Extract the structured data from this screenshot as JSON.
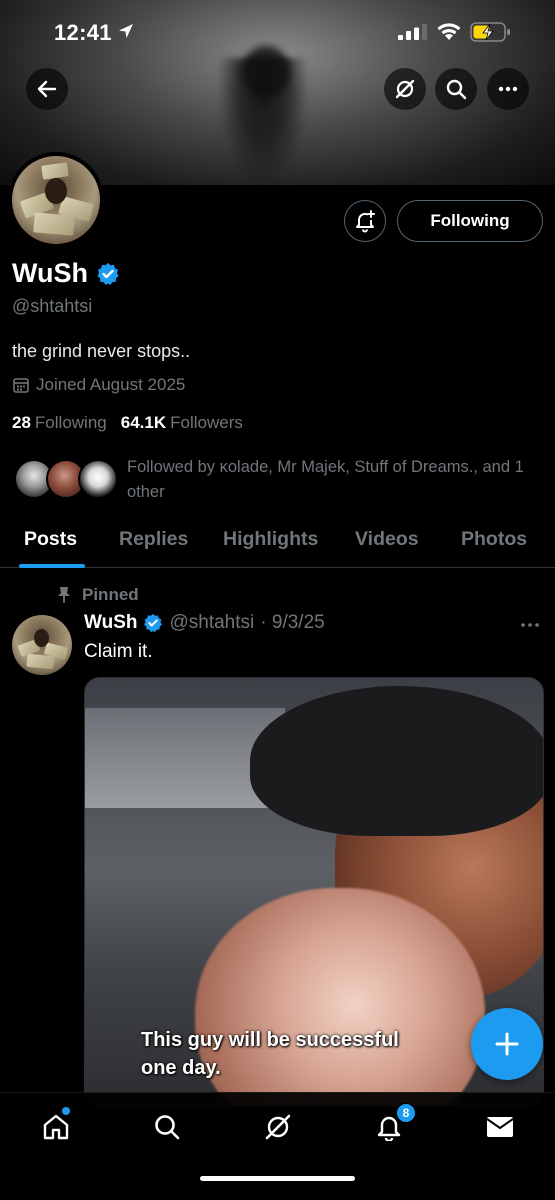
{
  "status_bar": {
    "time": "12:41"
  },
  "profile": {
    "name": "WuSh",
    "handle": "@shtahtsi",
    "bio": "the grind never stops..",
    "joined": "Joined August 2025",
    "following_count": "28",
    "following_label": "Following",
    "followers_count": "64.1K",
    "followers_label": "Followers",
    "followed_by": "Followed by κolade, Mr Majek, Stuff of Dreams., and 1 other"
  },
  "actions": {
    "following_button": "Following"
  },
  "tabs": [
    {
      "label": "Posts",
      "active": true
    },
    {
      "label": "Replies"
    },
    {
      "label": "Highlights"
    },
    {
      "label": "Videos"
    },
    {
      "label": "Photos"
    }
  ],
  "pinned_post": {
    "pinned_label": "Pinned",
    "author": "WuSh",
    "handle": "@shtahtsi",
    "date": "· 9/3/25",
    "text": "Claim it.",
    "media_caption": "This guy will be successful\none day."
  },
  "bottom_nav": {
    "items": [
      "home-icon",
      "search-icon",
      "grok-icon",
      "notifications-icon",
      "messages-icon"
    ],
    "notification_badge": "8"
  },
  "colors": {
    "accent": "#1d9bf0",
    "background": "#000000",
    "muted": "#71767b"
  }
}
